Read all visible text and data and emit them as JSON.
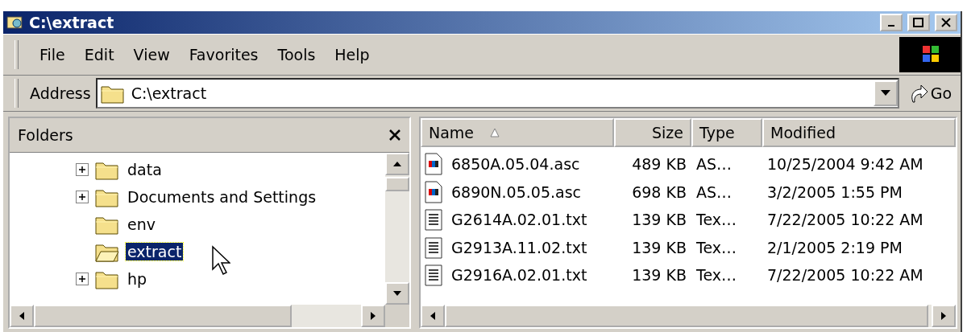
{
  "window": {
    "title": "C:\\extract"
  },
  "menu": [
    "File",
    "Edit",
    "View",
    "Favorites",
    "Tools",
    "Help"
  ],
  "address": {
    "label": "Address",
    "value": "C:\\extract",
    "go": "Go"
  },
  "folders": {
    "title": "Folders",
    "items": [
      {
        "name": "data",
        "expandable": true,
        "selected": false
      },
      {
        "name": "Documents and Settings",
        "expandable": true,
        "selected": false
      },
      {
        "name": "env",
        "expandable": false,
        "selected": false
      },
      {
        "name": "extract",
        "expandable": false,
        "selected": true
      },
      {
        "name": "hp",
        "expandable": true,
        "selected": false
      }
    ]
  },
  "files": {
    "columns": [
      {
        "label": "Name",
        "sorted": true
      },
      {
        "label": "Size",
        "sorted": false
      },
      {
        "label": "Type",
        "sorted": false
      },
      {
        "label": "Modified",
        "sorted": false
      }
    ],
    "rows": [
      {
        "kind": "asc",
        "name": "6850A.05.04.asc",
        "size": "489 KB",
        "type": "AS…",
        "modified": "10/25/2004 9:42 AM"
      },
      {
        "kind": "asc",
        "name": "6890N.05.05.asc",
        "size": "698 KB",
        "type": "AS…",
        "modified": "3/2/2005 1:55 PM"
      },
      {
        "kind": "txt",
        "name": "G2614A.02.01.txt",
        "size": "139 KB",
        "type": "Tex…",
        "modified": "7/22/2005 10:22 AM"
      },
      {
        "kind": "txt",
        "name": "G2913A.11.02.txt",
        "size": "139 KB",
        "type": "Tex…",
        "modified": "2/1/2005 2:19 PM"
      },
      {
        "kind": "txt",
        "name": "G2916A.02.01.txt",
        "size": "139 KB",
        "type": "Tex…",
        "modified": "7/22/2005 10:22 AM"
      }
    ]
  }
}
